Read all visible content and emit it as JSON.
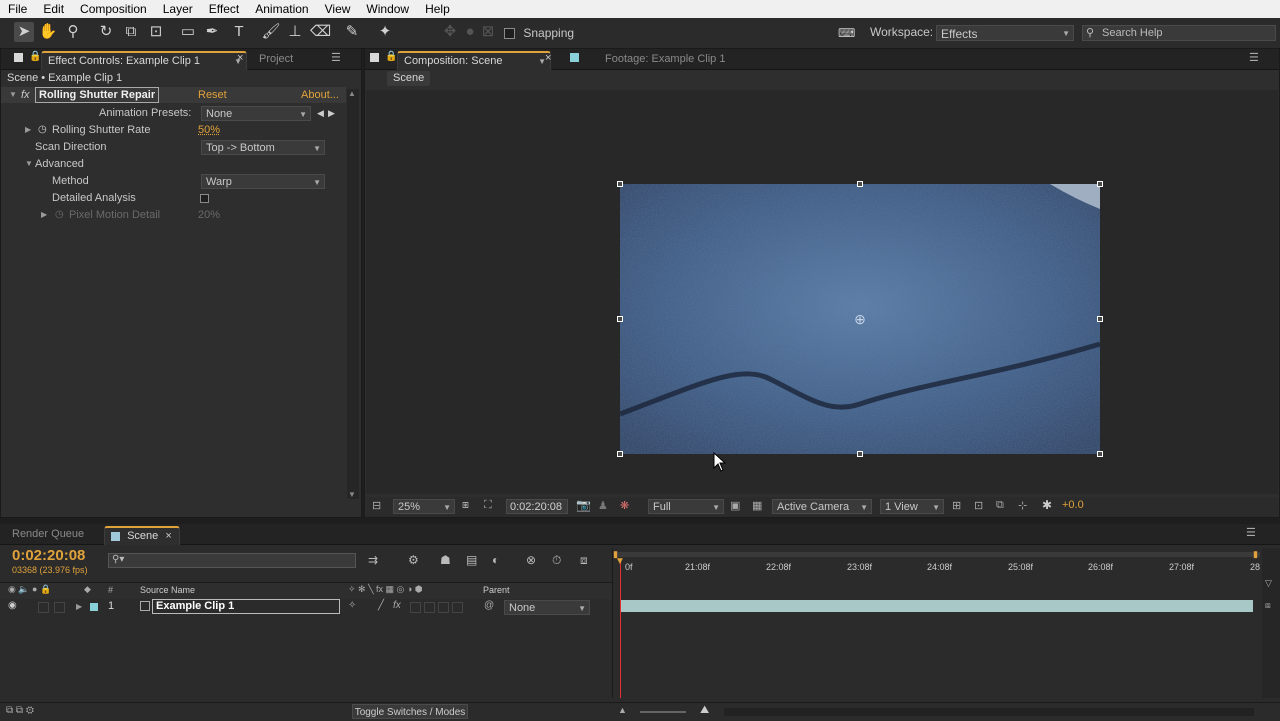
{
  "menu": [
    "File",
    "Edit",
    "Composition",
    "Layer",
    "Effect",
    "Animation",
    "View",
    "Window",
    "Help"
  ],
  "toolbar": {
    "snapping_label": "Snapping",
    "workspace_label": "Workspace:",
    "workspace_value": "Effects",
    "search_placeholder": "Search Help"
  },
  "effect_panel": {
    "tab_effect": "Effect Controls: Example Clip 1",
    "tab_project": "Project",
    "breadcrumb": "Scene • Example Clip 1",
    "effect_name": "Rolling Shutter Repair",
    "reset": "Reset",
    "about": "About...",
    "presets_label": "Animation Presets:",
    "presets_value": "None",
    "rate_label": "Rolling Shutter Rate",
    "rate_value": "50%",
    "scan_label": "Scan Direction",
    "scan_value": "Top -> Bottom",
    "advanced_label": "Advanced",
    "method_label": "Method",
    "method_value": "Warp",
    "detailed_label": "Detailed Analysis",
    "pixel_label": "Pixel Motion Detail",
    "pixel_value": "20%"
  },
  "comp_panel": {
    "tab_comp": "Composition: Scene",
    "tab_footage": "Footage: Example Clip 1",
    "crumb": "Scene",
    "zoom": "25%",
    "timecode": "0:02:20:08",
    "resolution": "Full",
    "camera": "Active Camera",
    "views": "1 View",
    "exposure": "+0.0"
  },
  "timeline": {
    "tab_render": "Render Queue",
    "tab_scene": "Scene",
    "timecode": "0:02:20:08",
    "frames": "03368 (23.976 fps)",
    "col_source": "Source Name",
    "col_parent": "Parent",
    "col_num": "#",
    "layer_num": "1",
    "layer_name": "Example Clip 1",
    "layer_parent": "None",
    "toggle_label": "Toggle Switches / Modes",
    "ruler": [
      "0f",
      "21:08f",
      "22:08f",
      "23:08f",
      "24:08f",
      "25:08f",
      "26:08f",
      "27:08f",
      "28"
    ]
  }
}
